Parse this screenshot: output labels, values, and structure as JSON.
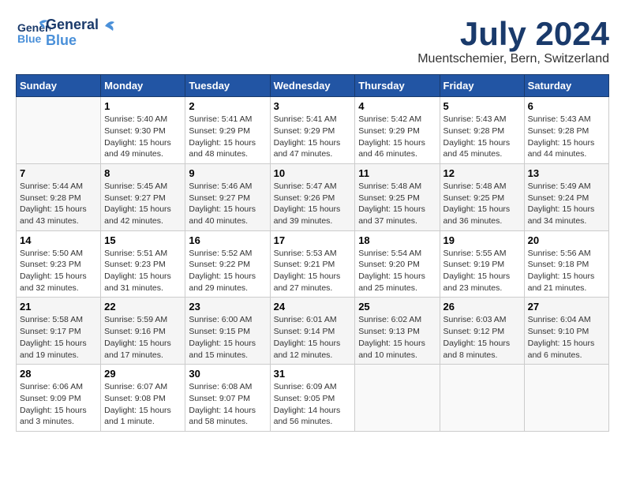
{
  "header": {
    "logo_general": "General",
    "logo_blue": "Blue",
    "month": "July 2024",
    "location": "Muentschemier, Bern, Switzerland"
  },
  "weekdays": [
    "Sunday",
    "Monday",
    "Tuesday",
    "Wednesday",
    "Thursday",
    "Friday",
    "Saturday"
  ],
  "weeks": [
    [
      {
        "day": "",
        "info": ""
      },
      {
        "day": "1",
        "info": "Sunrise: 5:40 AM\nSunset: 9:30 PM\nDaylight: 15 hours\nand 49 minutes."
      },
      {
        "day": "2",
        "info": "Sunrise: 5:41 AM\nSunset: 9:29 PM\nDaylight: 15 hours\nand 48 minutes."
      },
      {
        "day": "3",
        "info": "Sunrise: 5:41 AM\nSunset: 9:29 PM\nDaylight: 15 hours\nand 47 minutes."
      },
      {
        "day": "4",
        "info": "Sunrise: 5:42 AM\nSunset: 9:29 PM\nDaylight: 15 hours\nand 46 minutes."
      },
      {
        "day": "5",
        "info": "Sunrise: 5:43 AM\nSunset: 9:28 PM\nDaylight: 15 hours\nand 45 minutes."
      },
      {
        "day": "6",
        "info": "Sunrise: 5:43 AM\nSunset: 9:28 PM\nDaylight: 15 hours\nand 44 minutes."
      }
    ],
    [
      {
        "day": "7",
        "info": "Sunrise: 5:44 AM\nSunset: 9:28 PM\nDaylight: 15 hours\nand 43 minutes."
      },
      {
        "day": "8",
        "info": "Sunrise: 5:45 AM\nSunset: 9:27 PM\nDaylight: 15 hours\nand 42 minutes."
      },
      {
        "day": "9",
        "info": "Sunrise: 5:46 AM\nSunset: 9:27 PM\nDaylight: 15 hours\nand 40 minutes."
      },
      {
        "day": "10",
        "info": "Sunrise: 5:47 AM\nSunset: 9:26 PM\nDaylight: 15 hours\nand 39 minutes."
      },
      {
        "day": "11",
        "info": "Sunrise: 5:48 AM\nSunset: 9:25 PM\nDaylight: 15 hours\nand 37 minutes."
      },
      {
        "day": "12",
        "info": "Sunrise: 5:48 AM\nSunset: 9:25 PM\nDaylight: 15 hours\nand 36 minutes."
      },
      {
        "day": "13",
        "info": "Sunrise: 5:49 AM\nSunset: 9:24 PM\nDaylight: 15 hours\nand 34 minutes."
      }
    ],
    [
      {
        "day": "14",
        "info": "Sunrise: 5:50 AM\nSunset: 9:23 PM\nDaylight: 15 hours\nand 32 minutes."
      },
      {
        "day": "15",
        "info": "Sunrise: 5:51 AM\nSunset: 9:23 PM\nDaylight: 15 hours\nand 31 minutes."
      },
      {
        "day": "16",
        "info": "Sunrise: 5:52 AM\nSunset: 9:22 PM\nDaylight: 15 hours\nand 29 minutes."
      },
      {
        "day": "17",
        "info": "Sunrise: 5:53 AM\nSunset: 9:21 PM\nDaylight: 15 hours\nand 27 minutes."
      },
      {
        "day": "18",
        "info": "Sunrise: 5:54 AM\nSunset: 9:20 PM\nDaylight: 15 hours\nand 25 minutes."
      },
      {
        "day": "19",
        "info": "Sunrise: 5:55 AM\nSunset: 9:19 PM\nDaylight: 15 hours\nand 23 minutes."
      },
      {
        "day": "20",
        "info": "Sunrise: 5:56 AM\nSunset: 9:18 PM\nDaylight: 15 hours\nand 21 minutes."
      }
    ],
    [
      {
        "day": "21",
        "info": "Sunrise: 5:58 AM\nSunset: 9:17 PM\nDaylight: 15 hours\nand 19 minutes."
      },
      {
        "day": "22",
        "info": "Sunrise: 5:59 AM\nSunset: 9:16 PM\nDaylight: 15 hours\nand 17 minutes."
      },
      {
        "day": "23",
        "info": "Sunrise: 6:00 AM\nSunset: 9:15 PM\nDaylight: 15 hours\nand 15 minutes."
      },
      {
        "day": "24",
        "info": "Sunrise: 6:01 AM\nSunset: 9:14 PM\nDaylight: 15 hours\nand 12 minutes."
      },
      {
        "day": "25",
        "info": "Sunrise: 6:02 AM\nSunset: 9:13 PM\nDaylight: 15 hours\nand 10 minutes."
      },
      {
        "day": "26",
        "info": "Sunrise: 6:03 AM\nSunset: 9:12 PM\nDaylight: 15 hours\nand 8 minutes."
      },
      {
        "day": "27",
        "info": "Sunrise: 6:04 AM\nSunset: 9:10 PM\nDaylight: 15 hours\nand 6 minutes."
      }
    ],
    [
      {
        "day": "28",
        "info": "Sunrise: 6:06 AM\nSunset: 9:09 PM\nDaylight: 15 hours\nand 3 minutes."
      },
      {
        "day": "29",
        "info": "Sunrise: 6:07 AM\nSunset: 9:08 PM\nDaylight: 15 hours\nand 1 minute."
      },
      {
        "day": "30",
        "info": "Sunrise: 6:08 AM\nSunset: 9:07 PM\nDaylight: 14 hours\nand 58 minutes."
      },
      {
        "day": "31",
        "info": "Sunrise: 6:09 AM\nSunset: 9:05 PM\nDaylight: 14 hours\nand 56 minutes."
      },
      {
        "day": "",
        "info": ""
      },
      {
        "day": "",
        "info": ""
      },
      {
        "day": "",
        "info": ""
      }
    ]
  ]
}
